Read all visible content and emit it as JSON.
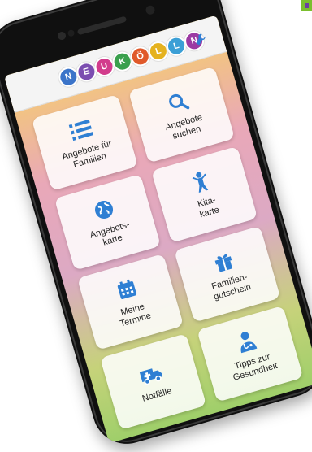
{
  "app": {
    "logo_letters": [
      "N",
      "E",
      "U",
      "K",
      "Ö",
      "L",
      "L",
      "N"
    ],
    "logo_colors": [
      "#3b74c9",
      "#7b4db0",
      "#d23c8c",
      "#3aa04d",
      "#e0592a",
      "#e5b21f",
      "#3b9fd6",
      "#9c3aa3"
    ],
    "settings_icon": "wrench-icon"
  },
  "tiles": [
    {
      "label": "Angebote für\nFamilien",
      "icon": "list-icon"
    },
    {
      "label": "Angebote\nsuchen",
      "icon": "search-icon"
    },
    {
      "label": "Angebots-\nkarte",
      "icon": "globe-icon"
    },
    {
      "label": "Kita-\nkarte",
      "icon": "child-icon"
    },
    {
      "label": "Meine\nTermine",
      "icon": "calendar-icon"
    },
    {
      "label": "Familien-\ngutschein",
      "icon": "gift-icon"
    },
    {
      "label": "Notfälle",
      "icon": "ambulance-icon"
    },
    {
      "label": "Tipps zur\nGesundheit",
      "icon": "doctor-icon"
    }
  ],
  "colors": {
    "accent": "#2f7fd3",
    "corner_green": "#7bbf2e",
    "corner_purple": "#6b3fa0"
  }
}
